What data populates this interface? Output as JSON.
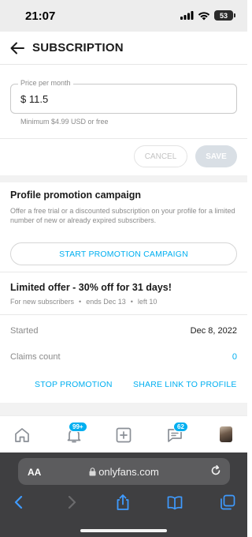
{
  "status_bar": {
    "time": "21:07",
    "battery": "53"
  },
  "header": {
    "title": "SUBSCRIPTION"
  },
  "price": {
    "label": "Price per month",
    "currency_symbol": "$",
    "value": "11.5",
    "helper": "Minimum $4.99 USD or free"
  },
  "actions": {
    "cancel_label": "CANCEL",
    "save_label": "SAVE"
  },
  "promotion": {
    "title": "Profile promotion campaign",
    "description": "Offer a free trial or a discounted subscription on your profile for a limited number of new or already expired subscribers.",
    "start_label": "START PROMOTION CAMPAIGN"
  },
  "offer": {
    "title": "Limited offer - 30% off for 31 days!",
    "audience": "For new subscribers",
    "ends": "ends Dec 13",
    "left": "left 10",
    "separator": "•",
    "started_label": "Started",
    "started_value": "Dec 8, 2022",
    "claims_label": "Claims count",
    "claims_value": "0",
    "stop_label": "STOP PROMOTION",
    "share_label": "SHARE LINK TO PROFILE"
  },
  "bottom_nav": {
    "notifications_badge": "99+",
    "messages_badge": "62"
  },
  "browser": {
    "aa_label": "AA",
    "url": "onlyfans.com"
  },
  "colors": {
    "accent": "#00aff0",
    "muted_text": "#8a8a8a",
    "browser_bg": "#3f3f41"
  }
}
